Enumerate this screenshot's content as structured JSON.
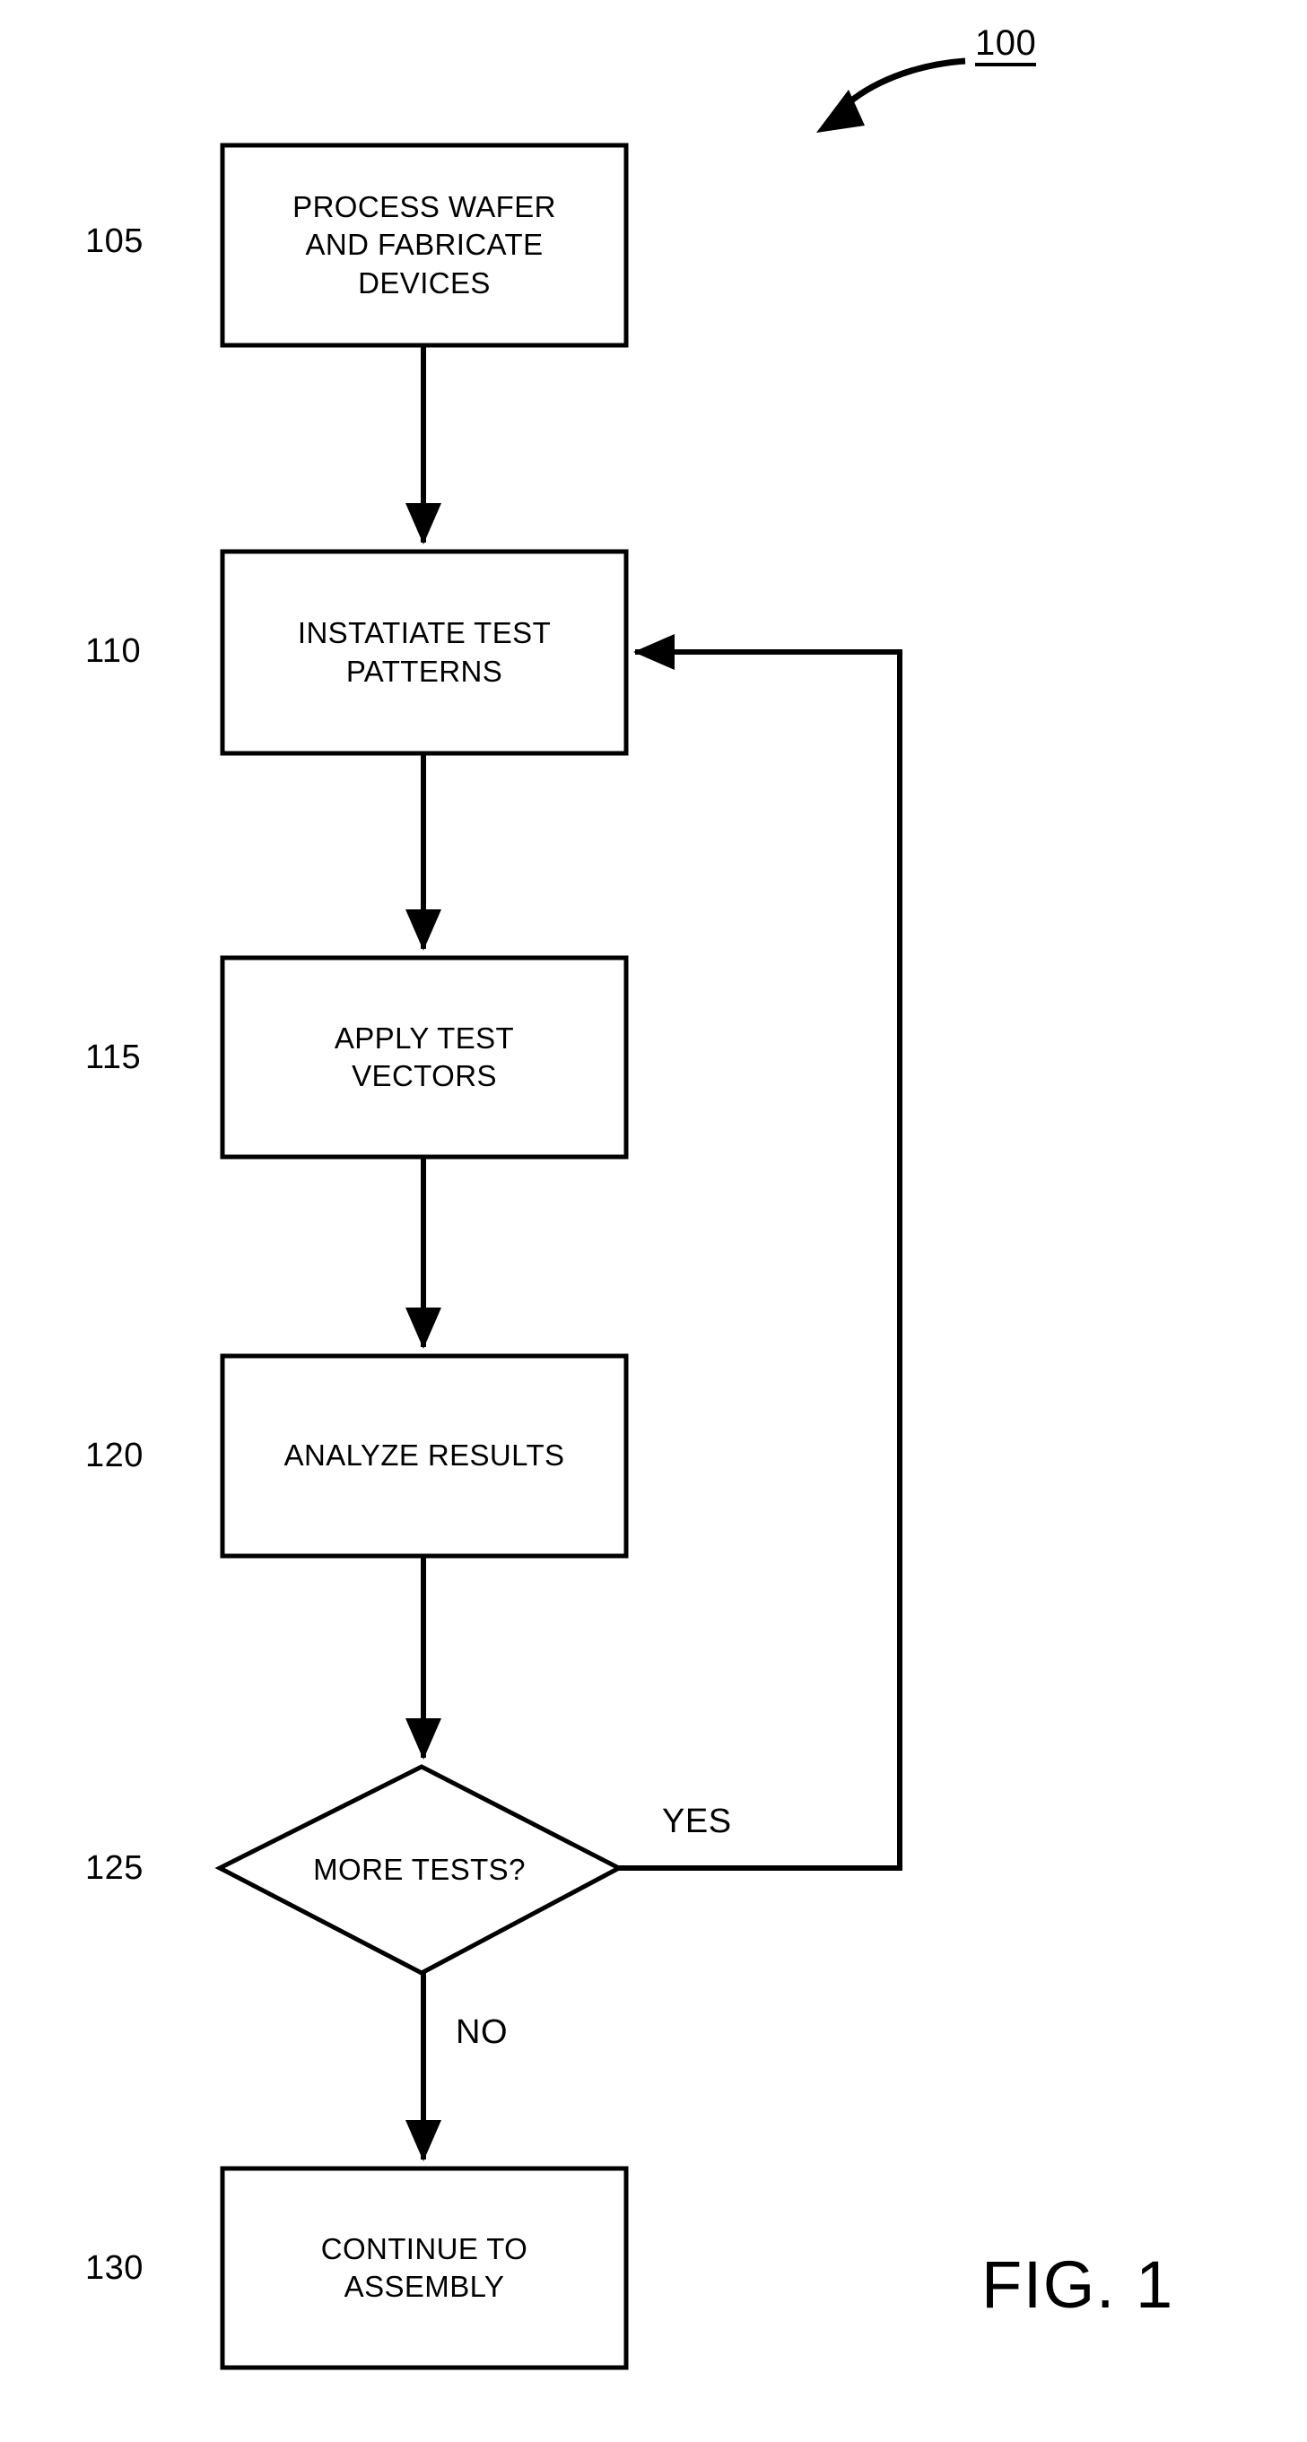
{
  "figure": {
    "number": "100",
    "caption": "FIG. 1",
    "type": "flowchart",
    "background_color": "#ffffff",
    "line_color": "#000000"
  },
  "nodes": [
    {
      "ref": "105",
      "shape": "process",
      "lines": [
        "PROCESS WAFER",
        "AND FABRICATE",
        "DEVICES"
      ]
    },
    {
      "ref": "110",
      "shape": "process",
      "lines": [
        "INSTATIATE TEST",
        "PATTERNS"
      ]
    },
    {
      "ref": "115",
      "shape": "process",
      "lines": [
        "APPLY TEST",
        "VECTORS"
      ]
    },
    {
      "ref": "120",
      "shape": "process",
      "lines": [
        "ANALYZE RESULTS"
      ]
    },
    {
      "ref": "125",
      "shape": "decision",
      "lines": [
        "MORE TESTS?"
      ]
    },
    {
      "ref": "130",
      "shape": "process",
      "lines": [
        "CONTINUE TO",
        "ASSEMBLY"
      ]
    }
  ],
  "branches": {
    "yes": "YES",
    "no": "NO"
  }
}
